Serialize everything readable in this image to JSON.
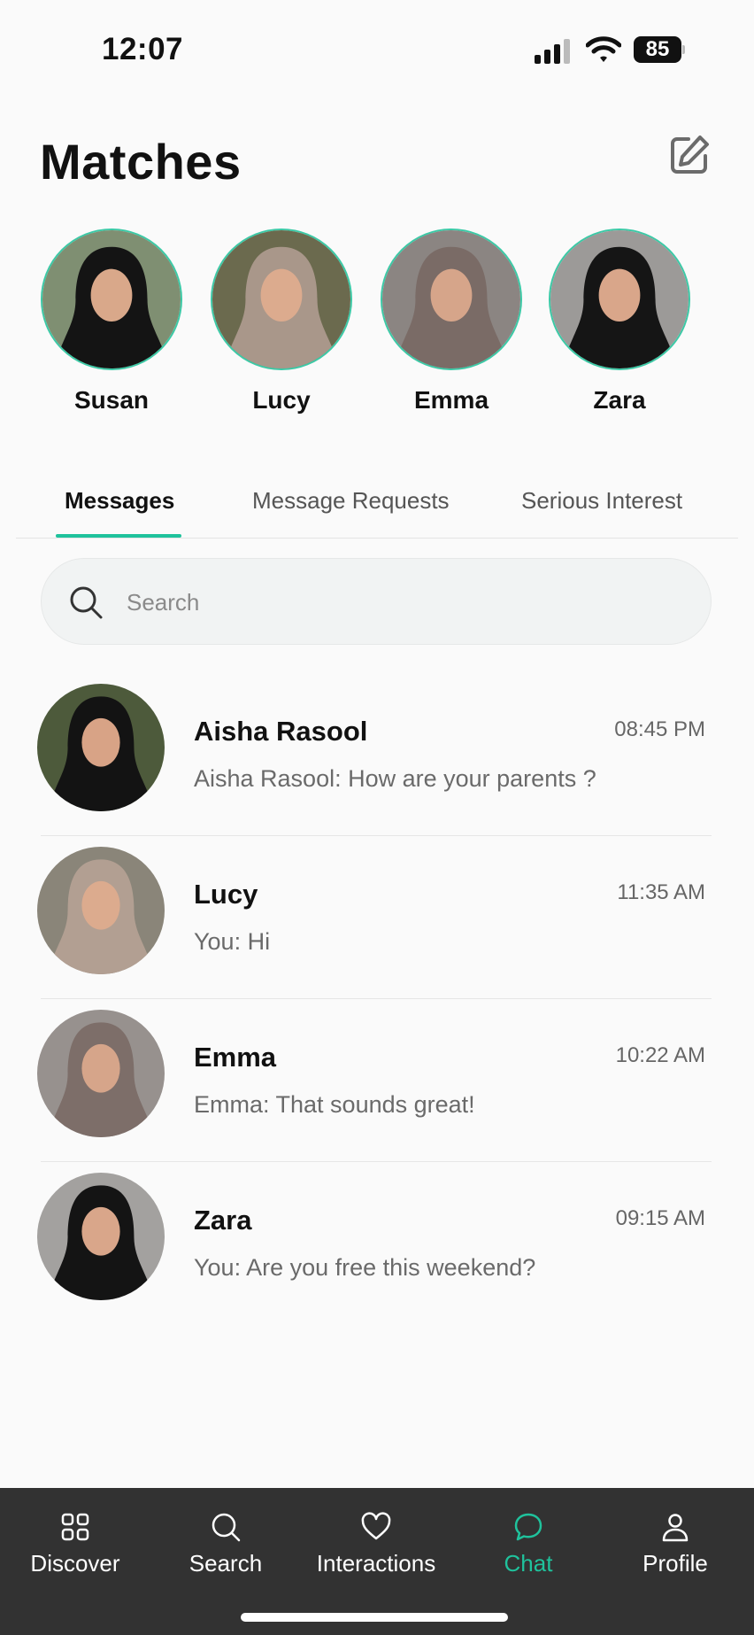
{
  "status_bar": {
    "time": "12:07",
    "battery": "85"
  },
  "header": {
    "title": "Matches"
  },
  "matches": [
    {
      "name": "Susan",
      "bg": "#7f8f72",
      "scarf": "#141414",
      "skin": "#d9a88a"
    },
    {
      "name": "Lucy",
      "bg": "#6b6a4e",
      "scarf": "#a9978a",
      "skin": "#dcab8e"
    },
    {
      "name": "Emma",
      "bg": "#8b8582",
      "scarf": "#7a6b66",
      "skin": "#d6a58a"
    },
    {
      "name": "Zara",
      "bg": "#9c9a98",
      "scarf": "#151515",
      "skin": "#d9a68a"
    }
  ],
  "tabs": [
    {
      "label": "Messages"
    },
    {
      "label": "Message Requests"
    },
    {
      "label": "Serious Interest"
    }
  ],
  "search": {
    "placeholder": "Search"
  },
  "conversations": [
    {
      "name": "Aisha Rasool",
      "time": "08:45 PM",
      "preview": "Aisha Rasool: How are your parents ?",
      "bg": "#4d5a3b",
      "scarf": "#131313",
      "skin": "#d8a386"
    },
    {
      "name": "Lucy",
      "time": "11:35 AM",
      "preview": "You: Hi",
      "bg": "#8a8579",
      "scarf": "#b29f92",
      "skin": "#dcab8e"
    },
    {
      "name": "Emma",
      "time": "10:22 AM",
      "preview": "Emma: That sounds great!",
      "bg": "#97918e",
      "scarf": "#7d6e69",
      "skin": "#d6a58a"
    },
    {
      "name": "Zara",
      "time": "09:15 AM",
      "preview": "You: Are you free this weekend?",
      "bg": "#a3a19f",
      "scarf": "#141414",
      "skin": "#d9a68a"
    }
  ],
  "nav": [
    {
      "label": "Discover",
      "icon": "grid-icon"
    },
    {
      "label": "Search",
      "icon": "search-icon"
    },
    {
      "label": "Interactions",
      "icon": "heart-icon"
    },
    {
      "label": "Chat",
      "icon": "chat-bubble-icon",
      "active": true
    },
    {
      "label": "Profile",
      "icon": "person-icon"
    }
  ],
  "colors": {
    "accent": "#1fc29c",
    "nav_bg": "#323232"
  }
}
